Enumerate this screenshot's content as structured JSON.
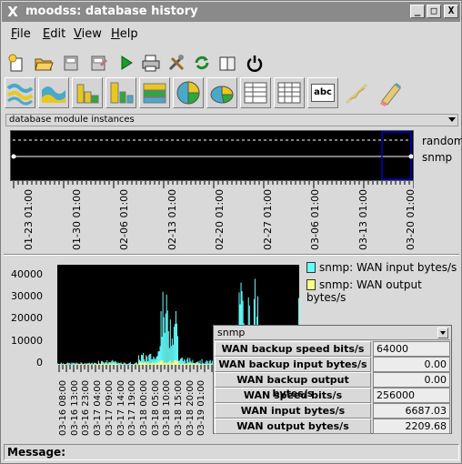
{
  "window": {
    "title": "moodss: database history",
    "minimize": "_",
    "maximize": "□",
    "close": "X"
  },
  "menu": [
    {
      "label": "File",
      "key": "F",
      "rest": "ile"
    },
    {
      "label": "Edit",
      "key": "E",
      "rest": "dit"
    },
    {
      "label": "View",
      "key": "V",
      "rest": "iew"
    },
    {
      "label": "Help",
      "key": "H",
      "rest": "elp"
    }
  ],
  "toolbar1": [
    "new-icon",
    "open-icon",
    "save-icon",
    "save-as-icon",
    "play-icon",
    "print-icon",
    "tools-icon",
    "refresh-icon",
    "book-icon",
    "power-icon"
  ],
  "toolbar2": [
    "graph-icon",
    "stacked-graph-icon",
    "bar-chart-icon",
    "stacked-bar-icon",
    "overlap-bar-icon",
    "pie-chart-icon",
    "pie-3d-icon",
    "table-icon",
    "summary-table-icon",
    "free-text-icon",
    "draw-icon",
    "eraser-icon"
  ],
  "toolbar2_text": {
    "free_text": "abc"
  },
  "module_bar": {
    "label": "database module instances"
  },
  "instances": [
    "random",
    "snmp"
  ],
  "timeline_ticks": [
    "01-23 01:00",
    "01-30 01:00",
    "02-06 01:00",
    "02-13 01:00",
    "02-20 01:00",
    "02-27 01:00",
    "03-06 01:00",
    "03-13 01:00",
    "03-20 01:00"
  ],
  "colors": {
    "input": "#66ffff",
    "output": "#ffff80",
    "selection": "#0000cc"
  },
  "chart_data": {
    "type": "area",
    "y_ticks": [
      "40000",
      "30000",
      "20000",
      "10000",
      "0"
    ],
    "ylim": [
      0,
      45000
    ],
    "x_ticks": [
      "03-16 08:00",
      "03-16 13:00",
      "03-16 23:00",
      "03-17 04:00",
      "03-17 09:00",
      "03-17 14:00",
      "03-17 19:00",
      "03-18 00:00",
      "03-18 05:00",
      "03-18 10:00",
      "03-18 15:00",
      "03-18 20:00",
      "03-19 01:00"
    ],
    "series": [
      {
        "name": "snmp: WAN input bytes/s",
        "values": [
          1000,
          1000,
          2000,
          1000,
          5000,
          30000,
          3000,
          2000,
          1000,
          30000,
          2000,
          1000,
          38000
        ]
      },
      {
        "name": "snmp: WAN output bytes/s",
        "values": [
          200,
          300,
          500,
          200,
          1000,
          1500,
          600,
          300,
          200,
          1500,
          400,
          200,
          2000
        ]
      }
    ]
  },
  "table": {
    "title": "snmp",
    "rows": [
      {
        "name": "WAN backup speed bits/s",
        "value": "64000",
        "align": "left"
      },
      {
        "name": "WAN backup input bytes/s",
        "value": "0.00",
        "align": "right"
      },
      {
        "name": "WAN backup output bytes/s",
        "value": "0.00",
        "align": "right"
      },
      {
        "name": "WAN speed bits/s",
        "value": "256000",
        "align": "left"
      },
      {
        "name": "WAN input bytes/s",
        "value": "6687.03",
        "align": "right"
      },
      {
        "name": "WAN output bytes/s",
        "value": "2209.68",
        "align": "right"
      }
    ]
  },
  "status": {
    "label": "Message:"
  }
}
